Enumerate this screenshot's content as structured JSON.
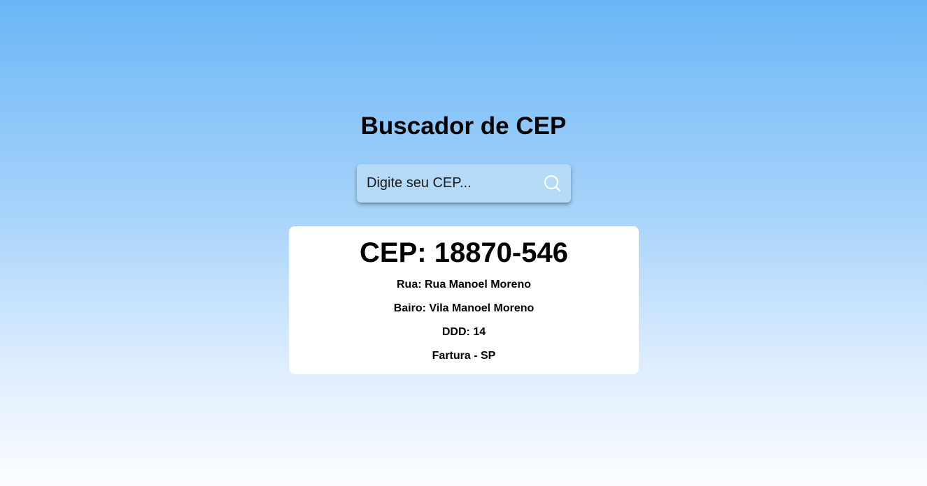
{
  "header": {
    "title": "Buscador de CEP"
  },
  "search": {
    "placeholder": "Digite seu CEP...",
    "icon": "search-icon",
    "icon_color": "#ffffff"
  },
  "result": {
    "cep_label": "CEP: 18870-546",
    "rua": "Rua: Rua Manoel Moreno",
    "bairro": "Bairo: Vila Manoel Moreno",
    "ddd": "DDD: 14",
    "cidade_uf": "Fartura - SP"
  },
  "colors": {
    "background_top": "#6ab6f6",
    "background_bottom": "#fbfdff",
    "search_box": "#b5daf8",
    "card": "#ffffff"
  }
}
